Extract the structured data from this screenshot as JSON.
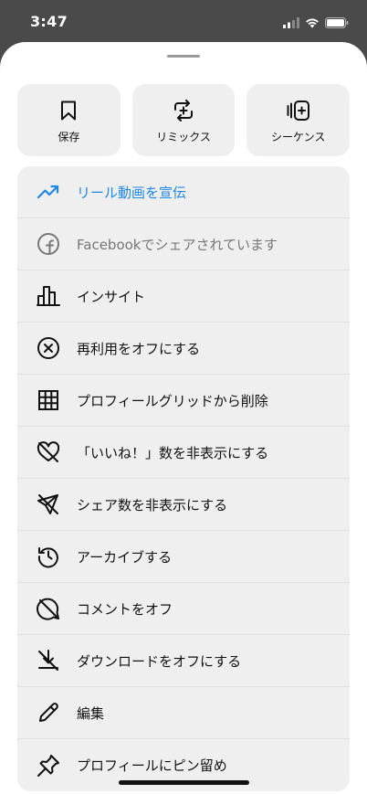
{
  "status": {
    "time": "3:47"
  },
  "top_actions": [
    {
      "label": "保存",
      "icon": "bookmark-icon"
    },
    {
      "label": "リミックス",
      "icon": "remix-icon"
    },
    {
      "label": "シーケンス",
      "icon": "sequence-icon"
    }
  ],
  "menu": {
    "items": [
      {
        "label": "リール動画を宣伝",
        "icon": "trending-up-icon"
      },
      {
        "label": "Facebookでシェアされています",
        "icon": "facebook-icon"
      },
      {
        "label": "インサイト",
        "icon": "bar-chart-icon"
      },
      {
        "label": "再利用をオフにする",
        "icon": "circle-x-icon"
      },
      {
        "label": "プロフィールグリッドから削除",
        "icon": "grid-icon"
      },
      {
        "label": "「いいね！」数を非表示にする",
        "icon": "heart-off-icon"
      },
      {
        "label": "シェア数を非表示にする",
        "icon": "send-off-icon"
      },
      {
        "label": "アーカイブする",
        "icon": "archive-history-icon"
      },
      {
        "label": "コメントをオフ",
        "icon": "comment-off-icon"
      },
      {
        "label": "ダウンロードをオフにする",
        "icon": "download-off-icon"
      },
      {
        "label": "編集",
        "icon": "pencil-icon"
      },
      {
        "label": "プロフィールにピン留め",
        "icon": "pin-icon"
      }
    ]
  },
  "colors": {
    "accent": "#1e88e5",
    "muted": "#777777",
    "surface": "#efefef"
  }
}
